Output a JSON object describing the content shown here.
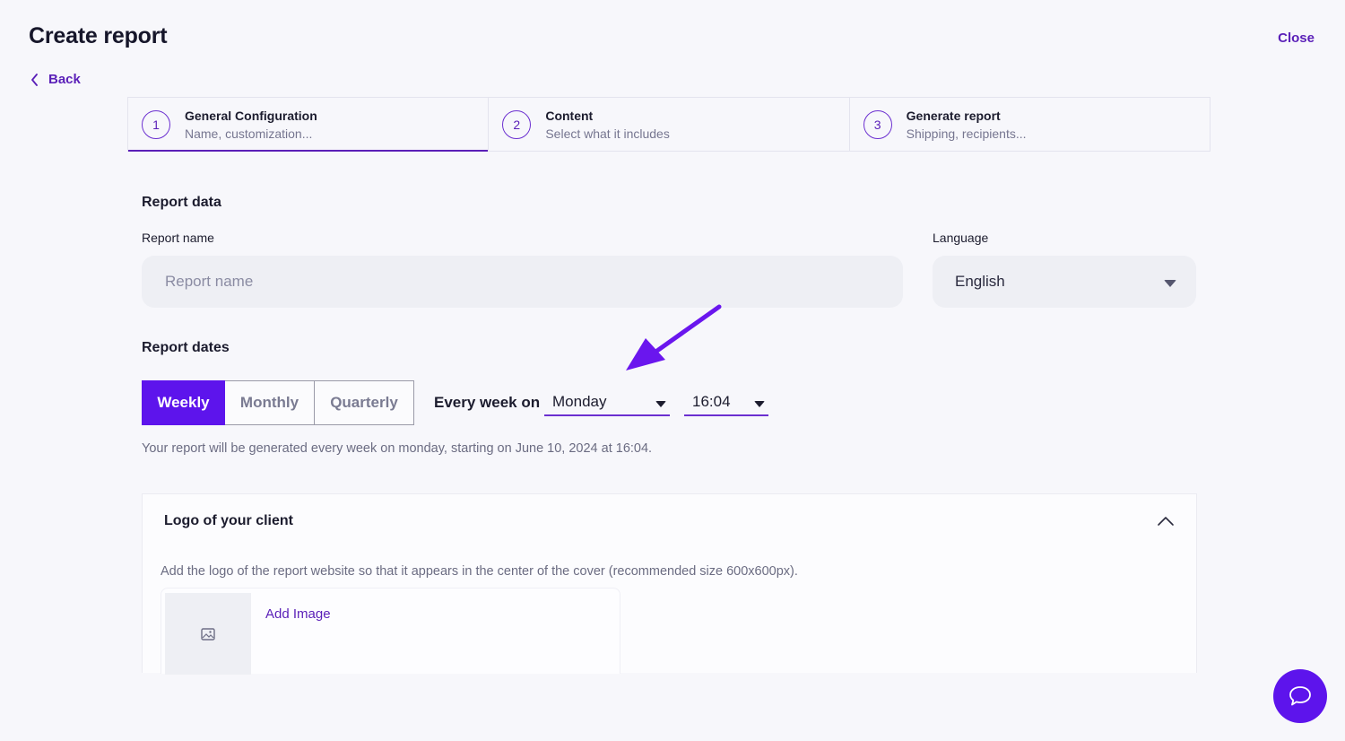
{
  "header": {
    "title": "Create report",
    "close_label": "Close",
    "back_label": "Back"
  },
  "stepper": {
    "active_step": 1,
    "steps": [
      {
        "number": "1",
        "title": "General Configuration",
        "subtitle": "Name, customization..."
      },
      {
        "number": "2",
        "title": "Content",
        "subtitle": "Select what it includes"
      },
      {
        "number": "3",
        "title": "Generate report",
        "subtitle": "Shipping, recipients..."
      }
    ]
  },
  "report_data": {
    "section_title": "Report data",
    "name_label": "Report name",
    "name_placeholder": "Report name",
    "name_value": "",
    "language_label": "Language",
    "language_value": "English"
  },
  "report_dates": {
    "section_title": "Report dates",
    "frequency_options": [
      "Weekly",
      "Monthly",
      "Quarterly"
    ],
    "frequency_selected": "Weekly",
    "every_label": "Every week on",
    "day_value": "Monday",
    "time_value": "16:04",
    "note": "Your report will be generated every week on monday, starting on June 10, 2024 at 16:04."
  },
  "logo_panel": {
    "title": "Logo of your client",
    "expanded": true,
    "description": "Add the logo of the report website so that it appears in the center of the cover (recommended size 600x600px).",
    "add_image_label": "Add Image"
  },
  "colors": {
    "accent": "#5d14ec",
    "link": "#5a1fb8",
    "background": "#f7f7fb"
  }
}
